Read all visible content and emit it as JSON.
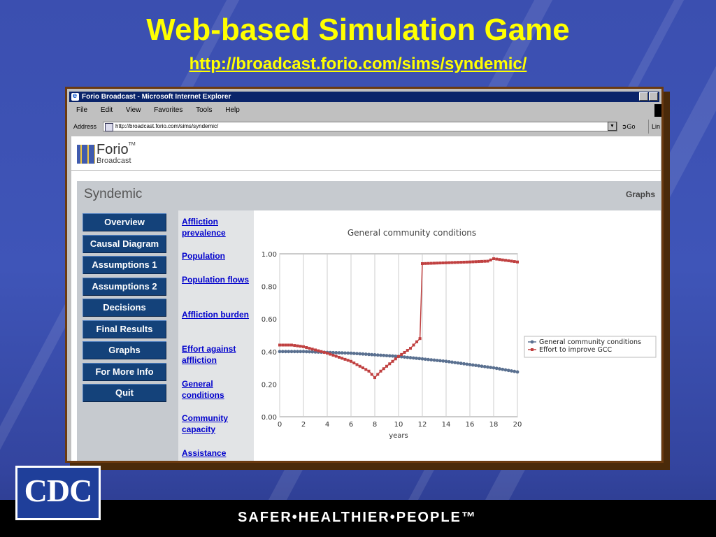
{
  "slide": {
    "title": "Web-based Simulation Game",
    "url": "http://broadcast.forio.com/sims/syndemic/",
    "footer": "SAFER•HEALTHIER•PEOPLE™",
    "logo_text": "CDC"
  },
  "browser": {
    "window_title": "Forio Broadcast - Microsoft Internet Explorer",
    "menu": [
      "File",
      "Edit",
      "View",
      "Favorites",
      "Tools",
      "Help"
    ],
    "address_label": "Address",
    "address": "http://broadcast.forio.com/sims/syndemic/",
    "go_label": "Go",
    "links_label": "Lin"
  },
  "app": {
    "brand_name": "Forio",
    "brand_tm": "TM",
    "brand_sub": "Broadcast",
    "title": "Syndemic",
    "section": "Graphs",
    "nav": [
      "Overview",
      "Causal Diagram",
      "Assumptions 1",
      "Assumptions 2",
      "Decisions",
      "Final Results",
      "Graphs",
      "For More Info",
      "Quit"
    ],
    "links": [
      "Affliction prevalence",
      "Population",
      "Population flows",
      "Affliction burden",
      "Effort against affliction",
      "General conditions",
      "Community capacity",
      "Assistance"
    ]
  },
  "chart_data": {
    "type": "line",
    "title": "General community conditions",
    "xlabel": "years",
    "ylabel": "",
    "xlim": [
      0,
      20
    ],
    "ylim": [
      0,
      1
    ],
    "x_ticks": [
      "0",
      "2",
      "4",
      "6",
      "8",
      "10",
      "12",
      "14",
      "16",
      "18",
      "20"
    ],
    "y_ticks": [
      "0.00",
      "0.20",
      "0.40",
      "0.60",
      "0.80",
      "1.00"
    ],
    "grid": "vertical",
    "legend": "right",
    "series": [
      {
        "name": "General community conditions",
        "color": "#5a7090",
        "x": [
          0,
          2,
          4,
          6,
          8,
          10,
          12,
          14,
          16,
          18,
          20
        ],
        "values": [
          0.4,
          0.4,
          0.395,
          0.39,
          0.38,
          0.37,
          0.355,
          0.34,
          0.32,
          0.3,
          0.275
        ]
      },
      {
        "name": "Effort to improve GCC",
        "color": "#c04040",
        "x": [
          0,
          1,
          2,
          3,
          4,
          6,
          7.5,
          8,
          8.5,
          9,
          10,
          11,
          11.8,
          12,
          14,
          16,
          17.5,
          18,
          19,
          20
        ],
        "values": [
          0.44,
          0.44,
          0.43,
          0.41,
          0.39,
          0.34,
          0.28,
          0.24,
          0.28,
          0.31,
          0.37,
          0.42,
          0.48,
          0.94,
          0.945,
          0.95,
          0.955,
          0.97,
          0.96,
          0.95
        ]
      }
    ]
  }
}
